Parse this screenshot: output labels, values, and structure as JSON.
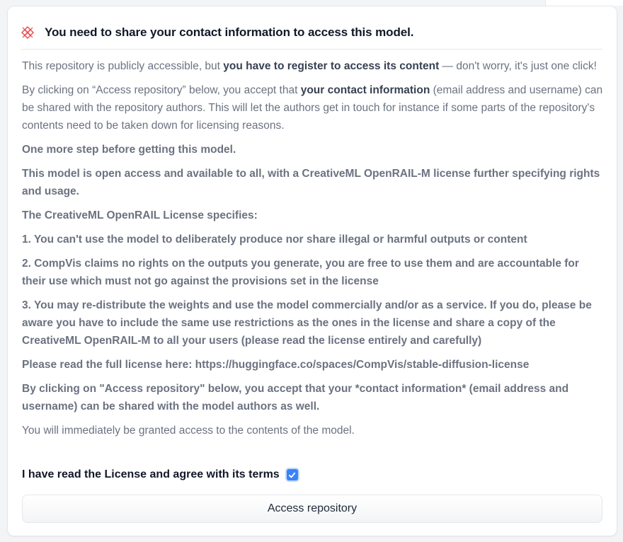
{
  "header": {
    "title": "You need to share your contact information to access this model."
  },
  "intro": {
    "p1_pre": "This repository is publicly accessible, but ",
    "p1_bold": "you have to register to access its content",
    "p1_post": " — don't worry, it's just one click!",
    "p2_pre": "By clicking on “Access repository” below, you accept that ",
    "p2_bold": "your contact information",
    "p2_post": " (email address and username) can be shared with the repository authors. This will let the authors get in touch for instance if some parts of the repository's contents need to be taken down for licensing reasons."
  },
  "license_text": [
    "One more step before getting this model.",
    "This model is open access and available to all, with a CreativeML OpenRAIL-M license further specifying rights and usage.",
    "The CreativeML OpenRAIL License specifies:",
    "1. You can't use the model to deliberately produce nor share illegal or harmful outputs or content",
    "2. CompVis claims no rights on the outputs you generate, you are free to use them and are accountable for their use which must not go against the provisions set in the license",
    "3. You may re-distribute the weights and use the model commercially and/or as a service. If you do, please be aware you have to include the same use restrictions as the ones in the license and share a copy of the CreativeML OpenRAIL-M to all your users (please read the license entirely and carefully)",
    "Please read the full license here: https://huggingface.co/spaces/CompVis/stable-diffusion-license",
    "By clicking on \"Access repository\" below, you accept that your *contact information* (email address and username) can be shared with the model authors as well."
  ],
  "footer_note": "You will immediately be granted access to the contents of the model.",
  "agreement": {
    "label": "I have read the License and agree with its terms",
    "checked": true
  },
  "access_button": {
    "label": "Access repository"
  },
  "colors": {
    "accent": "#3b82f6",
    "lock_icon": "#ef4444"
  },
  "icons": {
    "header": "gated-lock-icon",
    "checkbox": "checkmark-icon"
  }
}
